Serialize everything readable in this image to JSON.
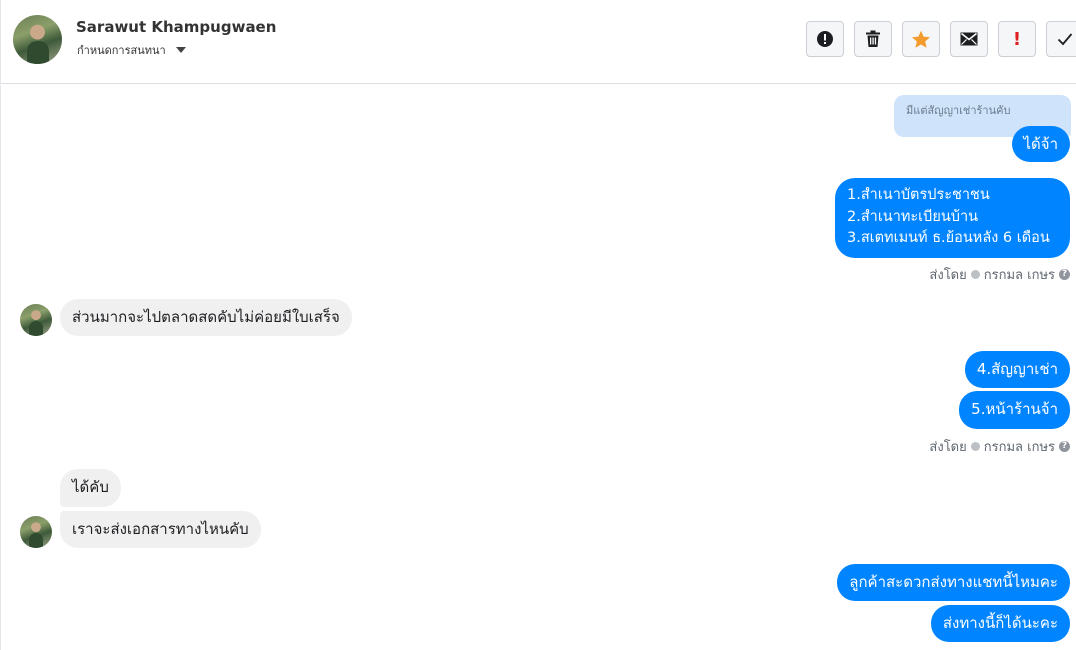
{
  "header": {
    "contact_name": "Sarawut Khampugwaen",
    "assign_label": "กำหนดการสนทนา",
    "toolbar": {
      "report_icon": "exclamation-circle-icon",
      "delete_icon": "trash-icon",
      "star_icon": "star-icon",
      "unread_icon": "envelope-icon",
      "spam_label": "!",
      "done_icon": "checkmark-icon"
    }
  },
  "colors": {
    "outgoing_bubble": "#0084ff",
    "incoming_bubble": "#f1f0f0",
    "star": "#f39c2d",
    "spam": "#e02020"
  },
  "messages": {
    "reply_quote": "มีแต่สัญญาเช่าร้านคับ",
    "m1": "ได้จ้า",
    "m2": "1.สำเนาบัตรประชาชน\n2.สำเนาทะเบียนบ้าน\n3.สเตทเมนท์ ธ.ย้อนหลัง 6 เดือน",
    "sent_by_1": {
      "prefix": "ส่งโดย",
      "name": "กรกมล เกษร"
    },
    "m3": "ส่วนมากจะไปตลาดสดคับไม่ค่อยมีใบเสร็จ",
    "m4": "4.สัญญาเช่า",
    "m5": "5.หน้าร้านจ้า",
    "sent_by_2": {
      "prefix": "ส่งโดย",
      "name": "กรกมล เกษร"
    },
    "m6": "ได้คับ",
    "m7": "เราจะส่งเอกสารทางไหนคับ",
    "m8": "ลูกค้าสะดวกส่งทางแชทนี้ไหมคะ",
    "m9": "ส่งทางนี้ก็ได้นะคะ"
  }
}
